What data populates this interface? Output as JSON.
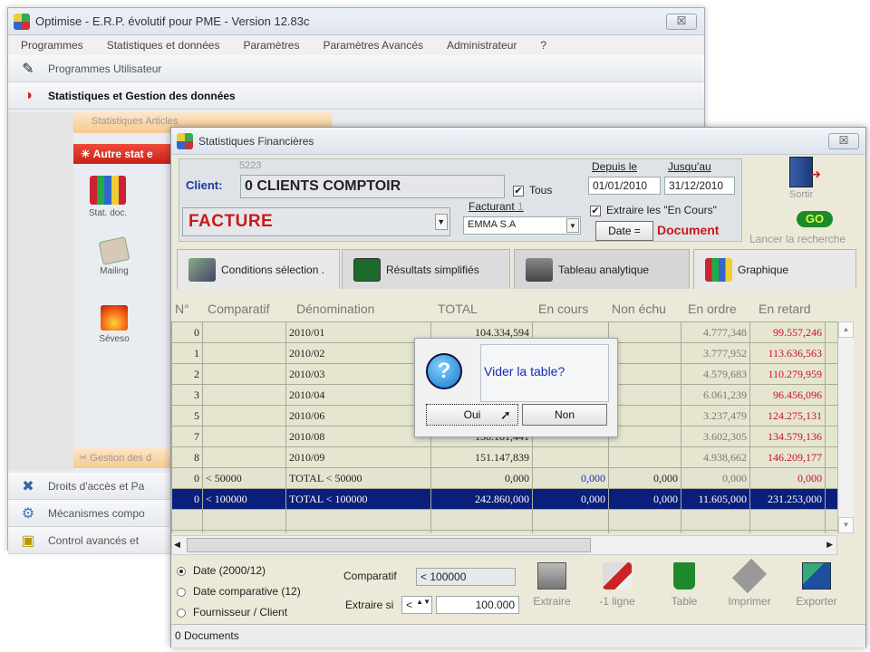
{
  "main_window": {
    "title": "Optimise  -  E.R.P. évolutif pour PME  -  Version 12.83c",
    "close_label": "☒",
    "menu": [
      "Programmes",
      "Statistiques et données",
      "Paramètres",
      "Paramètres Avancés",
      "Administrateur",
      "?"
    ],
    "nav": {
      "programmes_utilisateur": "Programmes Utilisateur",
      "stats_gestion": "Statistiques et Gestion des données",
      "statistiques_articles": "Statistiques Articles",
      "autre_stat": "Autre stat e",
      "gestion_donnees": "Gestion des d",
      "droits_acces": "Droits d'accès et Pa",
      "mecanismes": "Mécanismes compo",
      "control_avances": "Control avancés et"
    },
    "tools": [
      "Stat. doc.",
      "Mailing",
      "Séveso"
    ]
  },
  "dialog": {
    "title": "Statistiques Financières",
    "close_label": "☒",
    "client_code": "5223",
    "client_label": "Client:",
    "client_name": "0 CLIENTS COMPTOIR",
    "tous_label": "Tous",
    "doc_type": "FACTURE",
    "facturant_label": "Facturant",
    "facturant_num": "1",
    "facturant_value": "EMMA S.A",
    "depuis_label": "Depuis le",
    "jusqu_label": "Jusqu'au",
    "date_from": "01/01/2010",
    "date_to": "31/12/2010",
    "extraire_label": "Extraire les \"En Cours\"",
    "date_btn": "Date =",
    "document_label": "Document",
    "sortir_label": "Sortir",
    "go_label": "GO",
    "lancer_label": "Lancer la recherche",
    "tabs": [
      "Conditions sélection .",
      "Résultats simplifiés",
      "Tableau analytique",
      "Graphique"
    ],
    "columns": [
      "N°",
      "Comparatif",
      "Dénomination",
      "TOTAL",
      "En cours",
      "Non échu",
      "En ordre",
      "En retard"
    ],
    "rows": [
      {
        "n": "0",
        "comp": "",
        "denom": "2010/01",
        "total": "104.334,594",
        "encours": "",
        "nonechu": "",
        "ordre": "4.777,348",
        "retard": "99.557,246"
      },
      {
        "n": "1",
        "comp": "",
        "denom": "2010/02",
        "total": "",
        "encours": "",
        "nonechu": "",
        "ordre": "3.777,952",
        "retard": "113.636,563"
      },
      {
        "n": "2",
        "comp": "",
        "denom": "2010/03",
        "total": "",
        "encours": "",
        "nonechu": "",
        "ordre": "4.579,683",
        "retard": "110.279,959"
      },
      {
        "n": "3",
        "comp": "",
        "denom": "2010/04",
        "total": "",
        "encours": "",
        "nonechu": "",
        "ordre": "6.061,239",
        "retard": "96.456,096"
      },
      {
        "n": "5",
        "comp": "",
        "denom": "2010/06",
        "total": "",
        "encours": "",
        "nonechu": "",
        "ordre": "3.237,479",
        "retard": "124.275,131"
      },
      {
        "n": "7",
        "comp": "",
        "denom": "2010/08",
        "total": "138.181,441",
        "encours": "",
        "nonechu": "",
        "ordre": "3.602,305",
        "retard": "134.579,136"
      },
      {
        "n": "8",
        "comp": "",
        "denom": "2010/09",
        "total": "151.147,839",
        "encours": "",
        "nonechu": "",
        "ordre": "4.938,662",
        "retard": "146.209,177"
      },
      {
        "n": "0",
        "comp": "< 50000",
        "denom": "TOTAL  <  50000",
        "total": "0,000",
        "encours": "0,000",
        "nonechu": "0,000",
        "ordre": "0,000",
        "retard": "0,000"
      },
      {
        "n": "0",
        "comp": "< 100000",
        "denom": "TOTAL  <  100000",
        "total": "242.860,000",
        "encours": "0,000",
        "nonechu": "0,000",
        "ordre": "11.605,000",
        "retard": "231.253,000"
      }
    ],
    "radios": [
      "Date (2000/12)",
      "Date comparative (12)",
      "Fournisseur / Client"
    ],
    "comparatif_label": "Comparatif",
    "comparatif_value": "< 100000",
    "extraire_si_label": "Extraire si",
    "extraire_si_op": "<",
    "extraire_si_value": "100.000",
    "bottom_tools": [
      "Extraire",
      "-1 ligne",
      "Table",
      "Imprimer",
      "Exporter"
    ],
    "status": "0 Documents"
  },
  "msgbox": {
    "text": "Vider la table?",
    "yes": "Oui",
    "no": "Non"
  }
}
